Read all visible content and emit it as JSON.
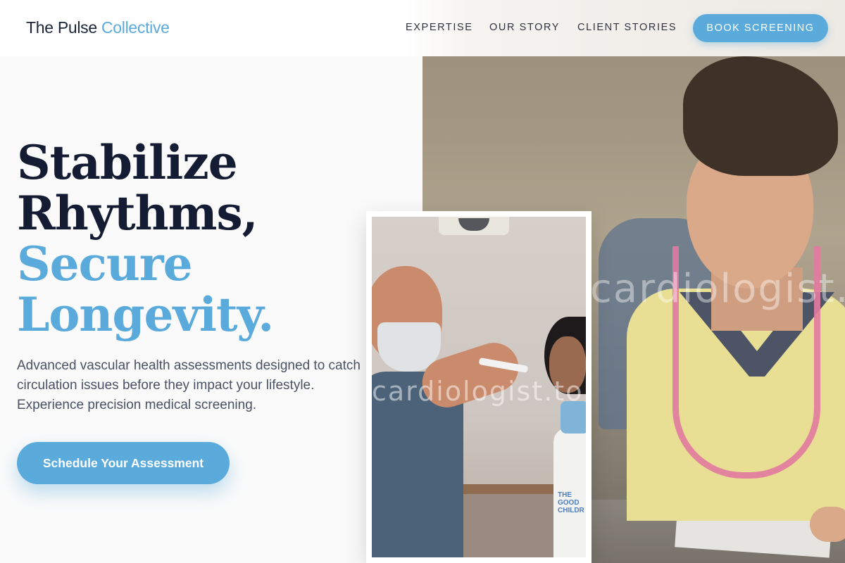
{
  "header": {
    "brand_name": "The Pulse",
    "brand_accent": "Collective",
    "nav": [
      {
        "label": "EXPERTISE"
      },
      {
        "label": "OUR STORY"
      },
      {
        "label": "CLIENT STORIES"
      }
    ],
    "cta_label": "BOOK SCREENING"
  },
  "hero": {
    "headline_line1": "Stabilize",
    "headline_line2": "Rhythms,",
    "headline_line3": "Secure",
    "headline_line4": "Longevity.",
    "subtext": "Advanced vascular health assessments designed to catch circulation issues before they impact your lifestyle. Experience precision medical screening.",
    "cta_label": "Schedule Your Assessment"
  },
  "images": {
    "main_watermark": "cardiologist.tokyo",
    "inset_watermark": "cardiologist.tokyo",
    "inset_shirt_text": "THE GOOD CHILDR"
  },
  "colors": {
    "accent": "#5aaadb",
    "heading": "#131c33",
    "body_text": "#4a5163",
    "background": "#fafafa"
  }
}
